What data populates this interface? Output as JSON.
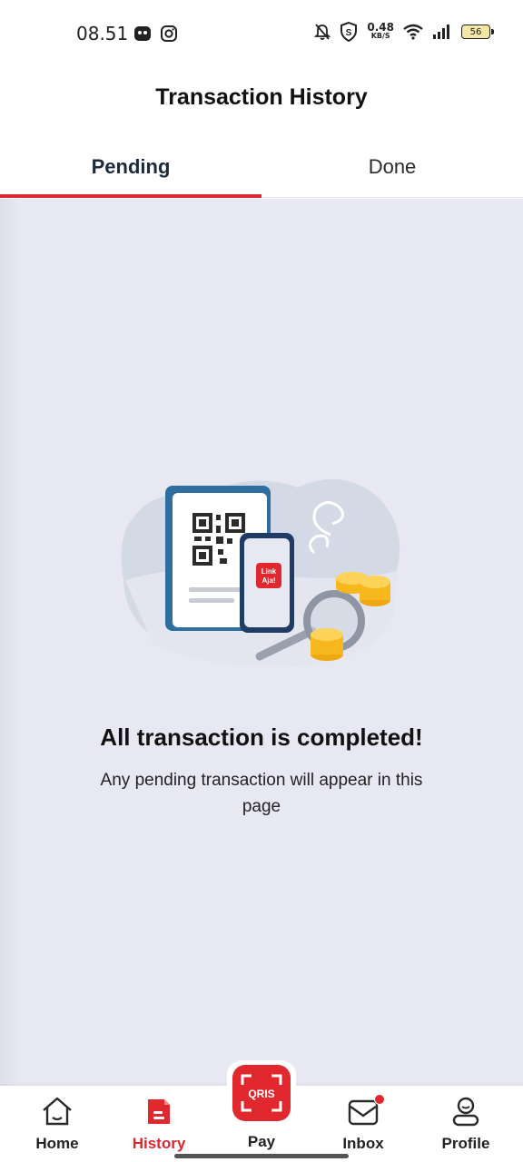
{
  "status_bar": {
    "time": "08.51",
    "net_speed_value": "0.48",
    "net_speed_unit": "KB/S",
    "battery_level": "56"
  },
  "header": {
    "title": "Transaction History"
  },
  "tabs": [
    {
      "label": "Pending",
      "active": true
    },
    {
      "label": "Done",
      "active": false
    }
  ],
  "empty_state": {
    "title": "All transaction is completed!",
    "description": "Any pending transaction will appear in this page",
    "illustration_brand": "Link Aja!"
  },
  "bottom_nav": {
    "items": [
      {
        "label": "Home",
        "icon": "home-icon"
      },
      {
        "label": "History",
        "icon": "history-icon",
        "active": true
      },
      {
        "label": "Pay",
        "icon": "qris-scan-icon"
      },
      {
        "label": "Inbox",
        "icon": "inbox-icon",
        "badge": true
      },
      {
        "label": "Profile",
        "icon": "profile-icon"
      }
    ]
  },
  "colors": {
    "accent": "#d9282f",
    "content_bg": "#e8e8f3",
    "coin": "#f7b81e"
  }
}
